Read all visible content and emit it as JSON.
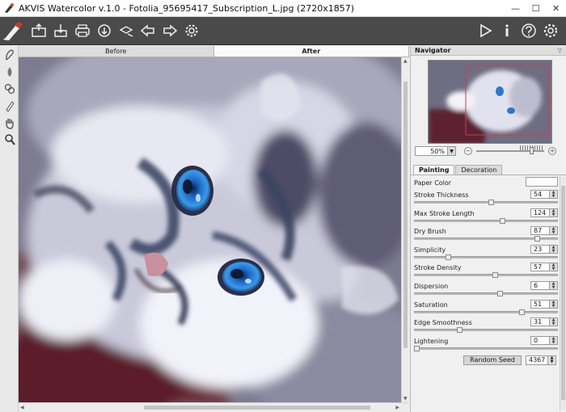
{
  "window": {
    "title": "AKVIS Watercolor v.1.0 - Fotolia_95695417_Subscription_L.jpg (2720x1857)",
    "minimize_glyph": "—",
    "maximize_glyph": "☐",
    "close_glyph": "✕"
  },
  "toolbar": {
    "left_icons": [
      "brush-logo-icon",
      "open-file-icon",
      "save-icon",
      "print-icon",
      "share-icon",
      "batch-icon",
      "back-arrow-icon",
      "forward-arrow-icon",
      "settings-gear-icon"
    ],
    "right_icons": [
      "run-play-icon",
      "info-icon",
      "help-icon",
      "preferences-gear-icon"
    ]
  },
  "left_tools": [
    "brush-tool-icon",
    "drop-tool-icon",
    "smudge-tool-icon",
    "eraser-tool-icon",
    "hand-tool-icon",
    "zoom-tool-icon"
  ],
  "view_tabs": [
    {
      "label": "Before",
      "active": false
    },
    {
      "label": "After",
      "active": true
    }
  ],
  "navigator": {
    "title": "Navigator",
    "zoom": "50%",
    "zoom_level_fraction": 0.83
  },
  "panel_tabs": [
    {
      "label": "Painting",
      "active": true
    },
    {
      "label": "Decoration",
      "active": false
    }
  ],
  "params": {
    "paper_color": {
      "label": "Paper Color",
      "color": "#fbfbfb"
    },
    "items": [
      {
        "label": "Stroke Thickness",
        "value": "54",
        "level": 0.54
      },
      {
        "label": "Max Stroke Length",
        "value": "124",
        "level": 0.62
      },
      {
        "label": "Dry Brush",
        "value": "87",
        "level": 0.87
      },
      {
        "label": "Simplicity",
        "value": "23",
        "level": 0.23
      },
      {
        "label": "Stroke Density",
        "value": "57",
        "level": 0.57
      },
      {
        "label": "Dispersion",
        "value": "6",
        "level": 0.6
      },
      {
        "label": "Saturation",
        "value": "51",
        "level": 0.76
      },
      {
        "label": "Edge Smoothness",
        "value": "31",
        "level": 0.31
      },
      {
        "label": "Lightening",
        "value": "0",
        "level": 0.0
      }
    ]
  },
  "seed": {
    "button_label": "Random Seed",
    "value": "4367"
  },
  "colors": {
    "toolbar_bg": "#4a4a4a",
    "canvas_bg": "#7b7a8e",
    "accent_eye_blue": "#2a7fd4"
  }
}
